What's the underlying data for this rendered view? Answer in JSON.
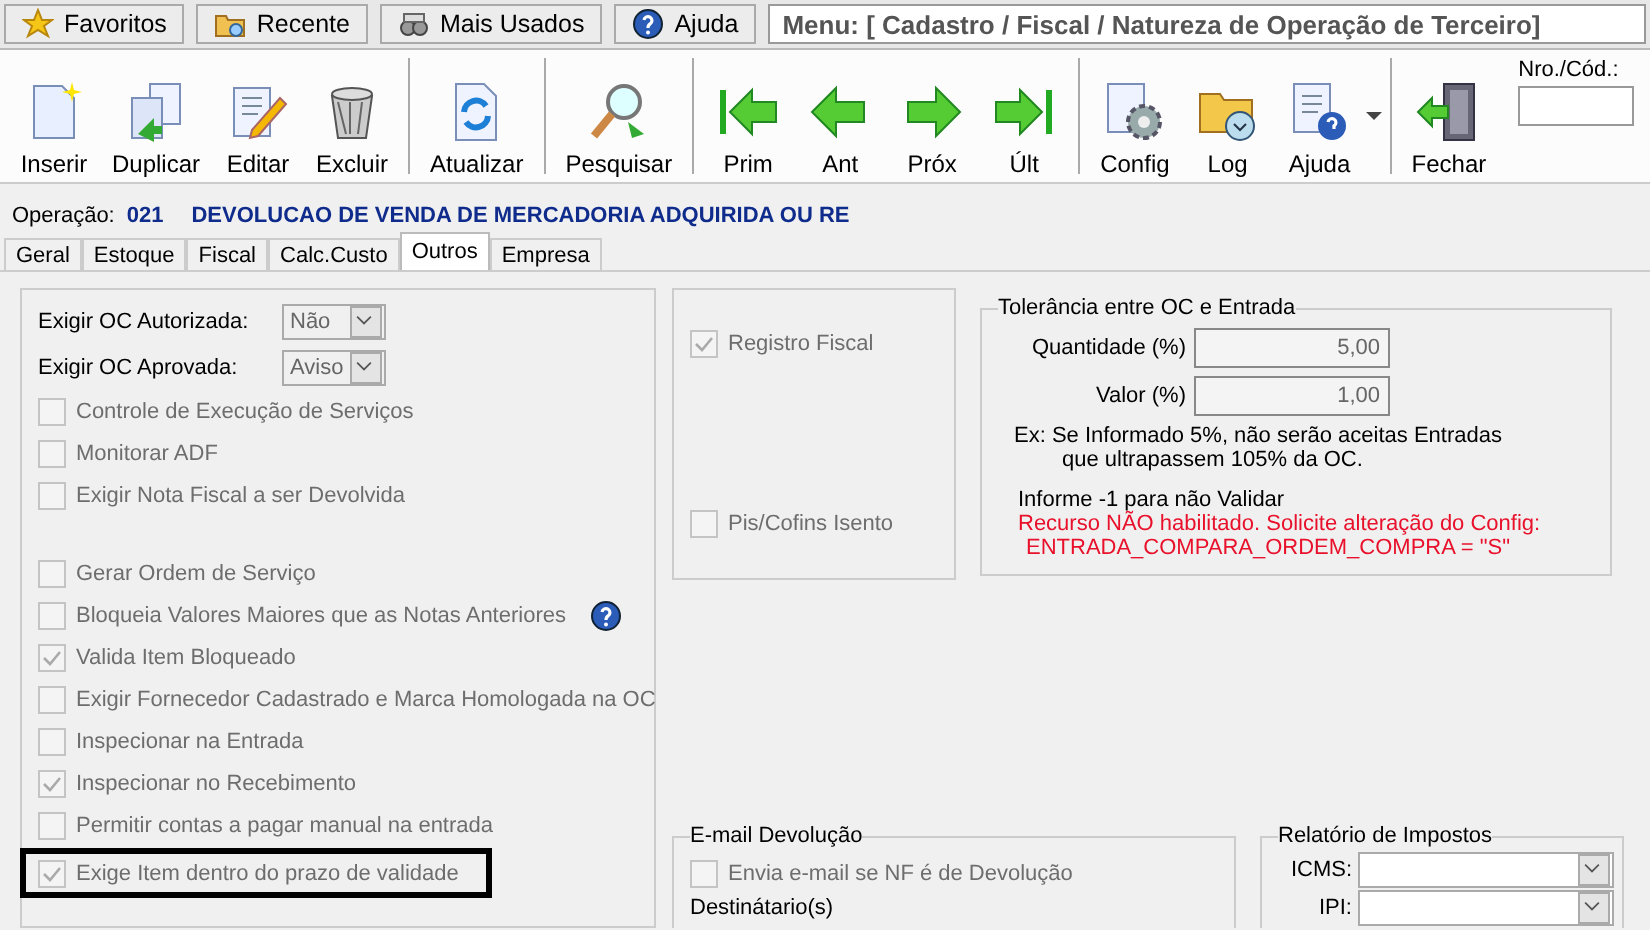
{
  "top_tabs": [
    {
      "label": "Favoritos"
    },
    {
      "label": "Recente"
    },
    {
      "label": "Mais Usados"
    },
    {
      "label": "Ajuda"
    }
  ],
  "menu_path": "Menu: [ Cadastro / Fiscal / Natureza de Operação de Terceiro]",
  "toolbar": [
    {
      "label": "Inserir"
    },
    {
      "label": "Duplicar"
    },
    {
      "label": "Editar"
    },
    {
      "label": "Excluir"
    },
    {
      "label": "Atualizar"
    },
    {
      "label": "Pesquisar"
    },
    {
      "label": "Prim"
    },
    {
      "label": "Ant"
    },
    {
      "label": "Próx"
    },
    {
      "label": "Últ"
    },
    {
      "label": "Config"
    },
    {
      "label": "Log"
    },
    {
      "label": "Ajuda"
    },
    {
      "label": "Fechar"
    }
  ],
  "code_field": {
    "label": "Nro./Cód.:"
  },
  "operation": {
    "label": "Operação:",
    "code": "021",
    "name": "DEVOLUCAO DE VENDA DE MERCADORIA ADQUIRIDA OU RE"
  },
  "tabs": [
    {
      "label": "Geral",
      "selected": false
    },
    {
      "label": "Estoque",
      "selected": false
    },
    {
      "label": "Fiscal",
      "selected": false
    },
    {
      "label": "Calc.Custo",
      "selected": false
    },
    {
      "label": "Outros",
      "selected": true
    },
    {
      "label": "Empresa",
      "selected": false
    }
  ],
  "left_panel": {
    "selects": [
      {
        "label": "Exigir OC Autorizada:",
        "value": "Não"
      },
      {
        "label": "Exigir OC Aprovada:",
        "value": "Aviso"
      }
    ],
    "checkboxes": [
      {
        "label": "Controle de Execução de Serviços",
        "checked": false
      },
      {
        "label": "Monitorar ADF",
        "checked": false
      },
      {
        "label": "Exigir Nota Fiscal a ser Devolvida",
        "checked": false
      },
      {
        "label": "Gerar Ordem de Serviço",
        "checked": false
      },
      {
        "label": "Bloqueia Valores Maiores que as Notas Anteriores",
        "checked": false
      },
      {
        "label": "Valida Item Bloqueado",
        "checked": true
      },
      {
        "label": "Exigir Fornecedor Cadastrado e Marca Homologada na OC",
        "checked": false
      },
      {
        "label": "Inspecionar na Entrada",
        "checked": false
      },
      {
        "label": "Inspecionar no Recebimento",
        "checked": true
      },
      {
        "label": "Permitir contas a pagar manual na entrada",
        "checked": false
      },
      {
        "label": "Exige Item dentro do prazo de validade",
        "checked": true
      }
    ]
  },
  "middle_panel": {
    "checkboxes": [
      {
        "label": "Registro Fiscal",
        "checked": true
      },
      {
        "label": "Pis/Cofins Isento",
        "checked": false
      }
    ]
  },
  "tolerance": {
    "title": "Tolerância entre OC e Entrada",
    "fields": [
      {
        "label": "Quantidade (%)",
        "value": "5,00"
      },
      {
        "label": "Valor (%)",
        "value": "1,00"
      }
    ],
    "example_lines": [
      "Ex: Se Informado 5%, não serão aceitas Entradas",
      "que ultrapassem 105% da OC."
    ],
    "hint": "Informe -1 para não Validar",
    "warning_lines": [
      "Recurso NÃO habilitado. Solicite alteração do Config:",
      "ENTRADA_COMPARA_ORDEM_COMPRA = \"S\""
    ]
  },
  "email_group": {
    "title": "E-mail Devolução",
    "checkbox": {
      "label": "Envia e-mail se NF é de Devolução",
      "checked": false
    },
    "recipients_label": "Destinátario(s)"
  },
  "tax_report": {
    "title": "Relatório de Impostos",
    "selects": [
      {
        "label": "ICMS:"
      },
      {
        "label": "IPI:"
      }
    ]
  }
}
